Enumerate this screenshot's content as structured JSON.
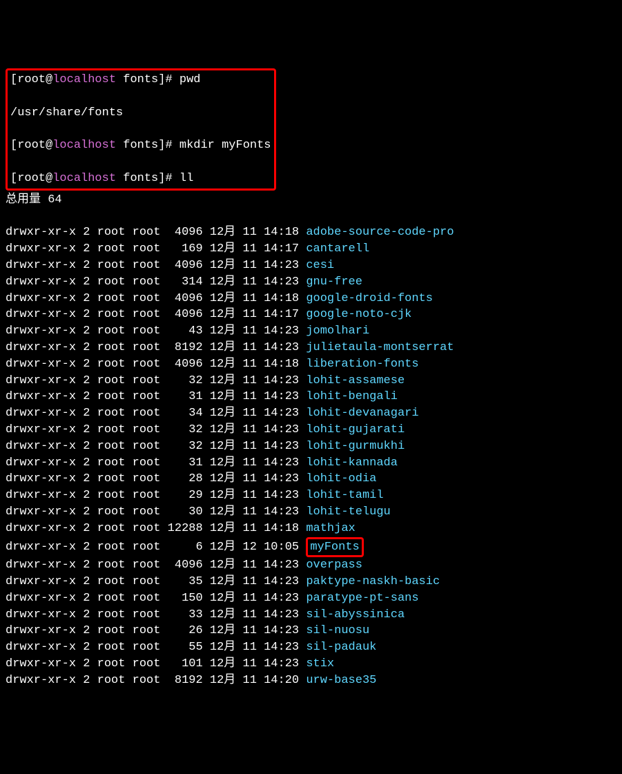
{
  "prompt": {
    "user": "root",
    "at": "@",
    "host": "localhost",
    "path": "fonts",
    "hash": "#"
  },
  "commands": {
    "pwd": "pwd",
    "pwd_output": "/usr/share/fonts",
    "mkdir": "mkdir myFonts",
    "ll": "ll"
  },
  "total": "总用量 64",
  "listing": [
    {
      "perms": "drwxr-xr-x",
      "links": "2",
      "owner": "root",
      "group": "root",
      "size": "4096",
      "month": "12月",
      "day": "11",
      "time": "14:18",
      "name": "adobe-source-code-pro",
      "highlight": false
    },
    {
      "perms": "drwxr-xr-x",
      "links": "2",
      "owner": "root",
      "group": "root",
      "size": "169",
      "month": "12月",
      "day": "11",
      "time": "14:17",
      "name": "cantarell",
      "highlight": false
    },
    {
      "perms": "drwxr-xr-x",
      "links": "2",
      "owner": "root",
      "group": "root",
      "size": "4096",
      "month": "12月",
      "day": "11",
      "time": "14:23",
      "name": "cesi",
      "highlight": false
    },
    {
      "perms": "drwxr-xr-x",
      "links": "2",
      "owner": "root",
      "group": "root",
      "size": "314",
      "month": "12月",
      "day": "11",
      "time": "14:23",
      "name": "gnu-free",
      "highlight": false
    },
    {
      "perms": "drwxr-xr-x",
      "links": "2",
      "owner": "root",
      "group": "root",
      "size": "4096",
      "month": "12月",
      "day": "11",
      "time": "14:18",
      "name": "google-droid-fonts",
      "highlight": false
    },
    {
      "perms": "drwxr-xr-x",
      "links": "2",
      "owner": "root",
      "group": "root",
      "size": "4096",
      "month": "12月",
      "day": "11",
      "time": "14:17",
      "name": "google-noto-cjk",
      "highlight": false
    },
    {
      "perms": "drwxr-xr-x",
      "links": "2",
      "owner": "root",
      "group": "root",
      "size": "43",
      "month": "12月",
      "day": "11",
      "time": "14:23",
      "name": "jomolhari",
      "highlight": false
    },
    {
      "perms": "drwxr-xr-x",
      "links": "2",
      "owner": "root",
      "group": "root",
      "size": "8192",
      "month": "12月",
      "day": "11",
      "time": "14:23",
      "name": "julietaula-montserrat",
      "highlight": false
    },
    {
      "perms": "drwxr-xr-x",
      "links": "2",
      "owner": "root",
      "group": "root",
      "size": "4096",
      "month": "12月",
      "day": "11",
      "time": "14:18",
      "name": "liberation-fonts",
      "highlight": false
    },
    {
      "perms": "drwxr-xr-x",
      "links": "2",
      "owner": "root",
      "group": "root",
      "size": "32",
      "month": "12月",
      "day": "11",
      "time": "14:23",
      "name": "lohit-assamese",
      "highlight": false
    },
    {
      "perms": "drwxr-xr-x",
      "links": "2",
      "owner": "root",
      "group": "root",
      "size": "31",
      "month": "12月",
      "day": "11",
      "time": "14:23",
      "name": "lohit-bengali",
      "highlight": false
    },
    {
      "perms": "drwxr-xr-x",
      "links": "2",
      "owner": "root",
      "group": "root",
      "size": "34",
      "month": "12月",
      "day": "11",
      "time": "14:23",
      "name": "lohit-devanagari",
      "highlight": false
    },
    {
      "perms": "drwxr-xr-x",
      "links": "2",
      "owner": "root",
      "group": "root",
      "size": "32",
      "month": "12月",
      "day": "11",
      "time": "14:23",
      "name": "lohit-gujarati",
      "highlight": false
    },
    {
      "perms": "drwxr-xr-x",
      "links": "2",
      "owner": "root",
      "group": "root",
      "size": "32",
      "month": "12月",
      "day": "11",
      "time": "14:23",
      "name": "lohit-gurmukhi",
      "highlight": false
    },
    {
      "perms": "drwxr-xr-x",
      "links": "2",
      "owner": "root",
      "group": "root",
      "size": "31",
      "month": "12月",
      "day": "11",
      "time": "14:23",
      "name": "lohit-kannada",
      "highlight": false
    },
    {
      "perms": "drwxr-xr-x",
      "links": "2",
      "owner": "root",
      "group": "root",
      "size": "28",
      "month": "12月",
      "day": "11",
      "time": "14:23",
      "name": "lohit-odia",
      "highlight": false
    },
    {
      "perms": "drwxr-xr-x",
      "links": "2",
      "owner": "root",
      "group": "root",
      "size": "29",
      "month": "12月",
      "day": "11",
      "time": "14:23",
      "name": "lohit-tamil",
      "highlight": false
    },
    {
      "perms": "drwxr-xr-x",
      "links": "2",
      "owner": "root",
      "group": "root",
      "size": "30",
      "month": "12月",
      "day": "11",
      "time": "14:23",
      "name": "lohit-telugu",
      "highlight": false
    },
    {
      "perms": "drwxr-xr-x",
      "links": "2",
      "owner": "root",
      "group": "root",
      "size": "12288",
      "month": "12月",
      "day": "11",
      "time": "14:18",
      "name": "mathjax",
      "highlight": false
    },
    {
      "perms": "drwxr-xr-x",
      "links": "2",
      "owner": "root",
      "group": "root",
      "size": "6",
      "month": "12月",
      "day": "12",
      "time": "10:05",
      "name": "myFonts",
      "highlight": true
    },
    {
      "perms": "drwxr-xr-x",
      "links": "2",
      "owner": "root",
      "group": "root",
      "size": "4096",
      "month": "12月",
      "day": "11",
      "time": "14:23",
      "name": "overpass",
      "highlight": false
    },
    {
      "perms": "drwxr-xr-x",
      "links": "2",
      "owner": "root",
      "group": "root",
      "size": "35",
      "month": "12月",
      "day": "11",
      "time": "14:23",
      "name": "paktype-naskh-basic",
      "highlight": false
    },
    {
      "perms": "drwxr-xr-x",
      "links": "2",
      "owner": "root",
      "group": "root",
      "size": "150",
      "month": "12月",
      "day": "11",
      "time": "14:23",
      "name": "paratype-pt-sans",
      "highlight": false
    },
    {
      "perms": "drwxr-xr-x",
      "links": "2",
      "owner": "root",
      "group": "root",
      "size": "33",
      "month": "12月",
      "day": "11",
      "time": "14:23",
      "name": "sil-abyssinica",
      "highlight": false
    },
    {
      "perms": "drwxr-xr-x",
      "links": "2",
      "owner": "root",
      "group": "root",
      "size": "26",
      "month": "12月",
      "day": "11",
      "time": "14:23",
      "name": "sil-nuosu",
      "highlight": false
    },
    {
      "perms": "drwxr-xr-x",
      "links": "2",
      "owner": "root",
      "group": "root",
      "size": "55",
      "month": "12月",
      "day": "11",
      "time": "14:23",
      "name": "sil-padauk",
      "highlight": false
    },
    {
      "perms": "drwxr-xr-x",
      "links": "2",
      "owner": "root",
      "group": "root",
      "size": "101",
      "month": "12月",
      "day": "11",
      "time": "14:23",
      "name": "stix",
      "highlight": false
    },
    {
      "perms": "drwxr-xr-x",
      "links": "2",
      "owner": "root",
      "group": "root",
      "size": "8192",
      "month": "12月",
      "day": "11",
      "time": "14:20",
      "name": "urw-base35",
      "highlight": false
    }
  ]
}
